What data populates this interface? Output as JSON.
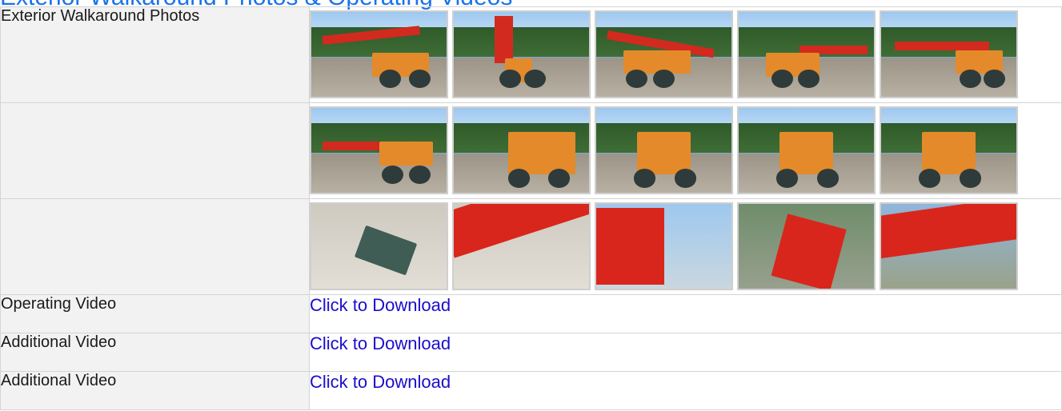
{
  "heading": "Exterior Walkaround Photos & Operating Videos",
  "photos_section": {
    "label": "Exterior Walkaround Photos",
    "rows": [
      [
        "crane-side-boom",
        "crane-front",
        "crane-boom-angle",
        "crane-side-orange",
        "crane-side-full"
      ],
      [
        "crane-side-wide",
        "crane-rear-quarter",
        "crane-rear",
        "crane-rear-trees",
        "crane-rear-center"
      ],
      [
        "hook-block",
        "boom-section",
        "boom-tip",
        "boom-tip-trees",
        "boom-head"
      ]
    ]
  },
  "videos": [
    {
      "label": "Operating Video",
      "link": "Click to Download"
    },
    {
      "label": "Additional Video",
      "link": "Click to Download"
    },
    {
      "label": "Additional Video",
      "link": "Click to Download"
    }
  ]
}
